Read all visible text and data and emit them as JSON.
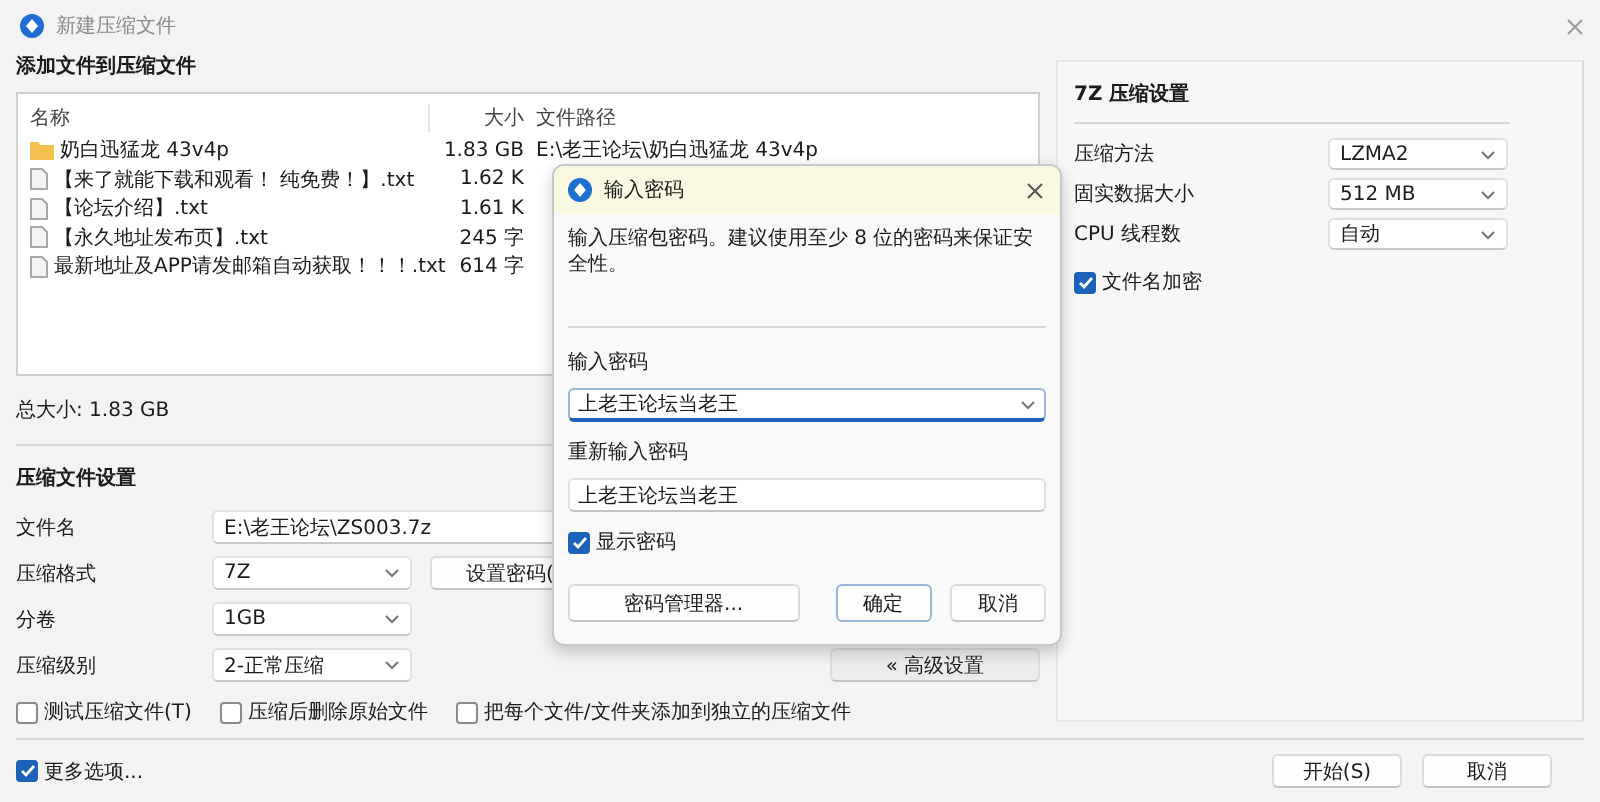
{
  "window": {
    "title": "新建压缩文件"
  },
  "files": {
    "heading": "添加文件到压缩文件",
    "columns": [
      "名称",
      "大小",
      "文件路径"
    ],
    "rows": [
      {
        "kind": "folder",
        "name": "奶白迅猛龙 43v4p",
        "size": "1.83 GB",
        "path": "E:\\老王论坛\\奶白迅猛龙 43v4p"
      },
      {
        "kind": "file",
        "name": "【来了就能下载和观看！ 纯免费！】.txt",
        "size": "1.62 K"
      },
      {
        "kind": "file",
        "name": "【论坛介绍】.txt",
        "size": "1.61 K"
      },
      {
        "kind": "file",
        "name": "【永久地址发布页】.txt",
        "size": "245 字"
      },
      {
        "kind": "file",
        "name": "最新地址及APP请发邮箱自动获取！！！.txt",
        "size": "614 字"
      }
    ]
  },
  "total_size": "总大小: 1.83 GB",
  "settings": {
    "heading": "压缩文件设置",
    "fields": [
      {
        "kind": "text",
        "label": "文件名",
        "value": "E:\\老王论坛\\ZS003.7z"
      },
      {
        "kind": "select",
        "label": "压缩格式",
        "value": "7Z"
      },
      {
        "kind": "select",
        "label": "分卷",
        "value": "1GB"
      },
      {
        "kind": "select",
        "label": "压缩级别",
        "value": "2-正常压缩"
      }
    ],
    "password_button": "设置密码(",
    "advanced_button": "« 高级设置",
    "options": [
      {
        "label": "测试压缩文件(T)",
        "checked": false
      },
      {
        "label": "压缩后删除原始文件",
        "checked": false
      },
      {
        "label": "把每个文件/文件夹添加到独立的压缩文件",
        "checked": false
      }
    ]
  },
  "more_options": {
    "label": "更多选项...",
    "checked": true
  },
  "seven_zip": {
    "heading": "7Z 压缩设置",
    "fields": [
      {
        "label": "压缩方法",
        "value": "LZMA2"
      },
      {
        "label": "固实数据大小",
        "value": "512 MB"
      },
      {
        "label": "CPU 线程数",
        "value": "自动"
      }
    ],
    "encrypt_names": {
      "label": "文件名加密",
      "checked": true
    }
  },
  "footer_buttons": [
    "开始(S)",
    "取消"
  ],
  "dialog": {
    "title": "输入密码",
    "hint": "输入压缩包密码。建议使用至少 8 位的密码来保证安全性。",
    "password_label": "输入密码",
    "password": "上老王论坛当老王",
    "confirm_label": "重新输入密码",
    "confirm": "上老王论坛当老王",
    "show_password": {
      "label": "显示密码",
      "checked": true
    },
    "manager_button": "密码管理器...",
    "ok_button": "确定",
    "cancel_button": "取消"
  }
}
